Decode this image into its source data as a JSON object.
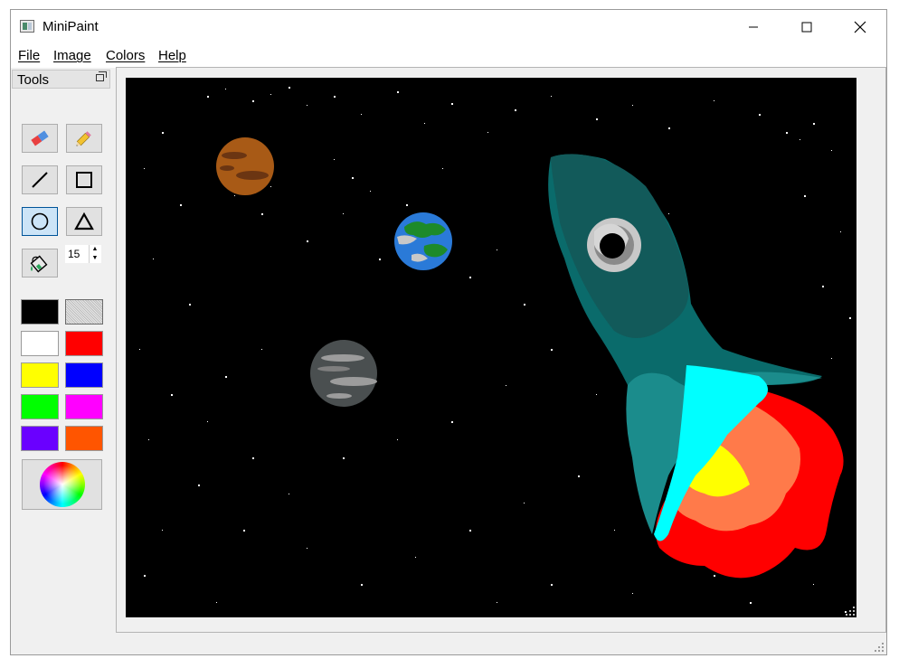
{
  "window": {
    "title": "MiniPaint"
  },
  "menu": {
    "items": [
      {
        "id": "file",
        "label": "File"
      },
      {
        "id": "image",
        "label": "Image"
      },
      {
        "id": "colors",
        "label": "Colors"
      },
      {
        "id": "help",
        "label": "Help"
      }
    ]
  },
  "tools": {
    "title": "Tools",
    "brush_size": "15",
    "active_tool": "ellipse-icon"
  },
  "palette": {
    "swatches": [
      "#000000",
      "#c8c8c8",
      "#ffffff",
      "#ff0000",
      "#ffff00",
      "#0000ff",
      "#00ff00",
      "#ff00ff",
      "#6a00ff",
      "#ff5500"
    ]
  },
  "canvas": {
    "background": "#000000"
  }
}
